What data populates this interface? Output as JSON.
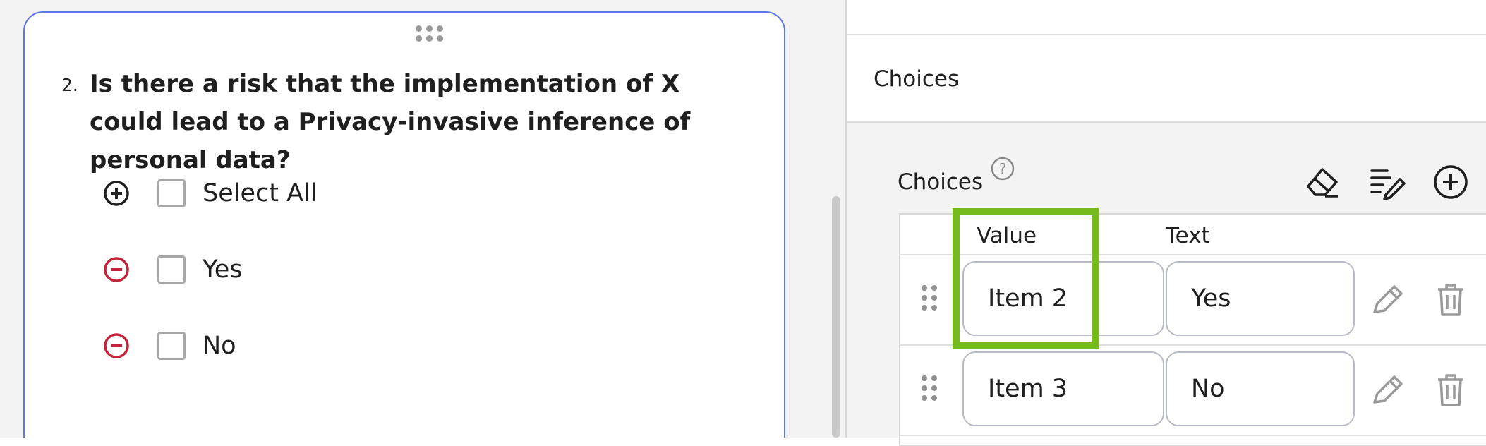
{
  "question": {
    "number": "2.",
    "title": "Is there a risk that the implementation of X could lead to a Privacy-invasive inference of personal data?",
    "choices": [
      {
        "label": "Select All",
        "op": "add"
      },
      {
        "label": "Yes",
        "op": "remove"
      },
      {
        "label": "No",
        "op": "remove"
      }
    ]
  },
  "panel": {
    "section_title": "Choices",
    "choices_label": "Choices",
    "columns": {
      "value": "Value",
      "text": "Text"
    },
    "rows": [
      {
        "value": "Item 2",
        "text": "Yes"
      },
      {
        "value": "Item 3",
        "text": "No"
      }
    ]
  },
  "colors": {
    "card_border": "#5b78e4",
    "remove_icon": "#c4213b",
    "highlight": "#76bb1c"
  },
  "icons": [
    "drag-handle-icon",
    "add-circle-icon",
    "remove-circle-icon",
    "help-icon",
    "eraser-icon",
    "edit-list-icon",
    "add-choice-icon",
    "pencil-icon",
    "trash-icon"
  ]
}
